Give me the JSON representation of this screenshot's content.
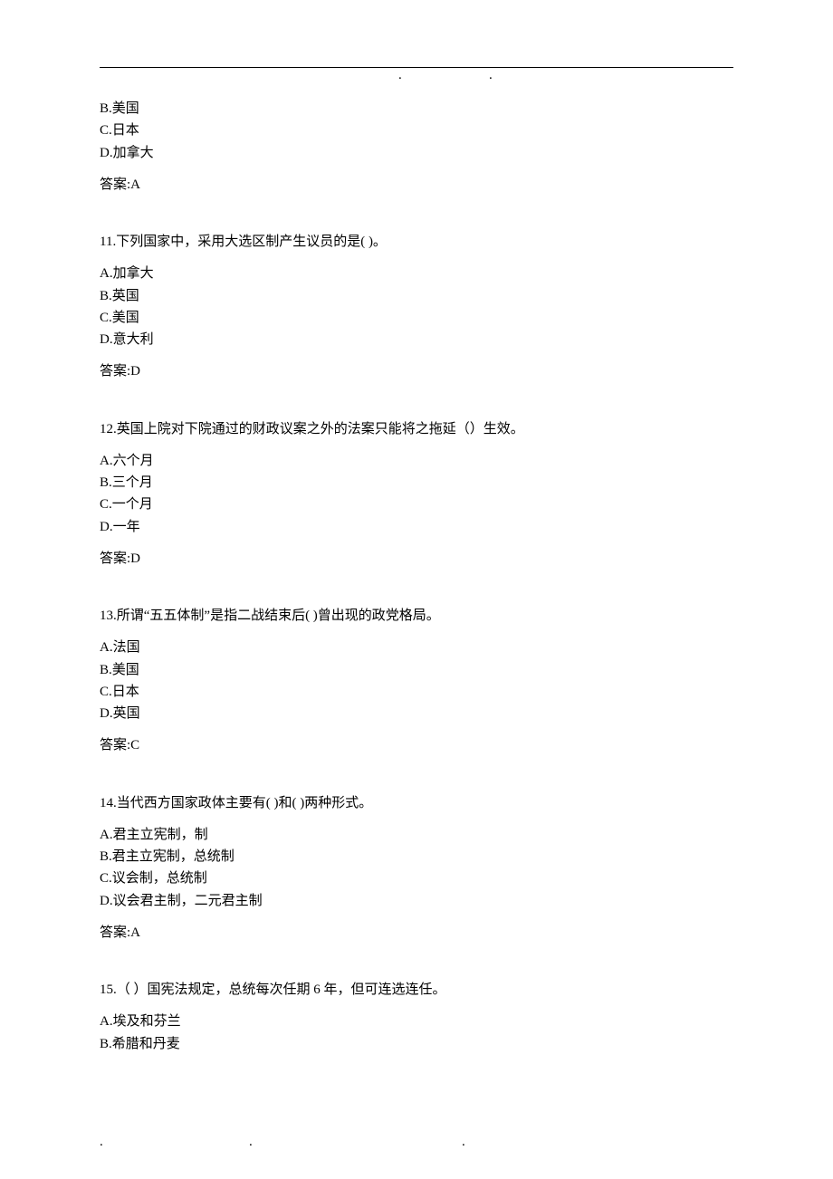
{
  "top": {
    "dot_left": ".",
    "dot_right": "."
  },
  "orphan_options": {
    "b": "B.美国",
    "c": "C.日本",
    "d": "D.加拿大",
    "answer": "答案:A"
  },
  "q11": {
    "stem": "11.下列国家中，采用大选区制产生议员的是(   )。",
    "a": "A.加拿大",
    "b": "B.英国",
    "c": "C.美国",
    "d": "D.意大利",
    "answer": "答案:D"
  },
  "q12": {
    "stem": "12.英国上院对下院通过的财政议案之外的法案只能将之拖延（）生效。",
    "a": "A.六个月",
    "b": "B.三个月",
    "c": "C.一个月",
    "d": "D.一年",
    "answer": "答案:D"
  },
  "q13": {
    "stem": "13.所谓“五五体制”是指二战结束后(   )曾出现的政党格局。",
    "a": "A.法国",
    "b": "B.美国",
    "c": "C.日本",
    "d": "D.英国",
    "answer": "答案:C"
  },
  "q14": {
    "stem": "14.当代西方国家政体主要有(   )和(   )两种形式。",
    "a": "A.君主立宪制，制",
    "b": "B.君主立宪制，总统制",
    "c": "C.议会制，总统制",
    "d": "D.议会君主制，二元君主制",
    "answer": "答案:A"
  },
  "q15": {
    "stem": "15.（   ）国宪法规定，总统每次任期 6 年，但可连选连任。",
    "a": "A.埃及和芬兰",
    "b": "B.希腊和丹麦"
  },
  "footer": {
    "a": ".",
    "b": ".",
    "c": "."
  }
}
